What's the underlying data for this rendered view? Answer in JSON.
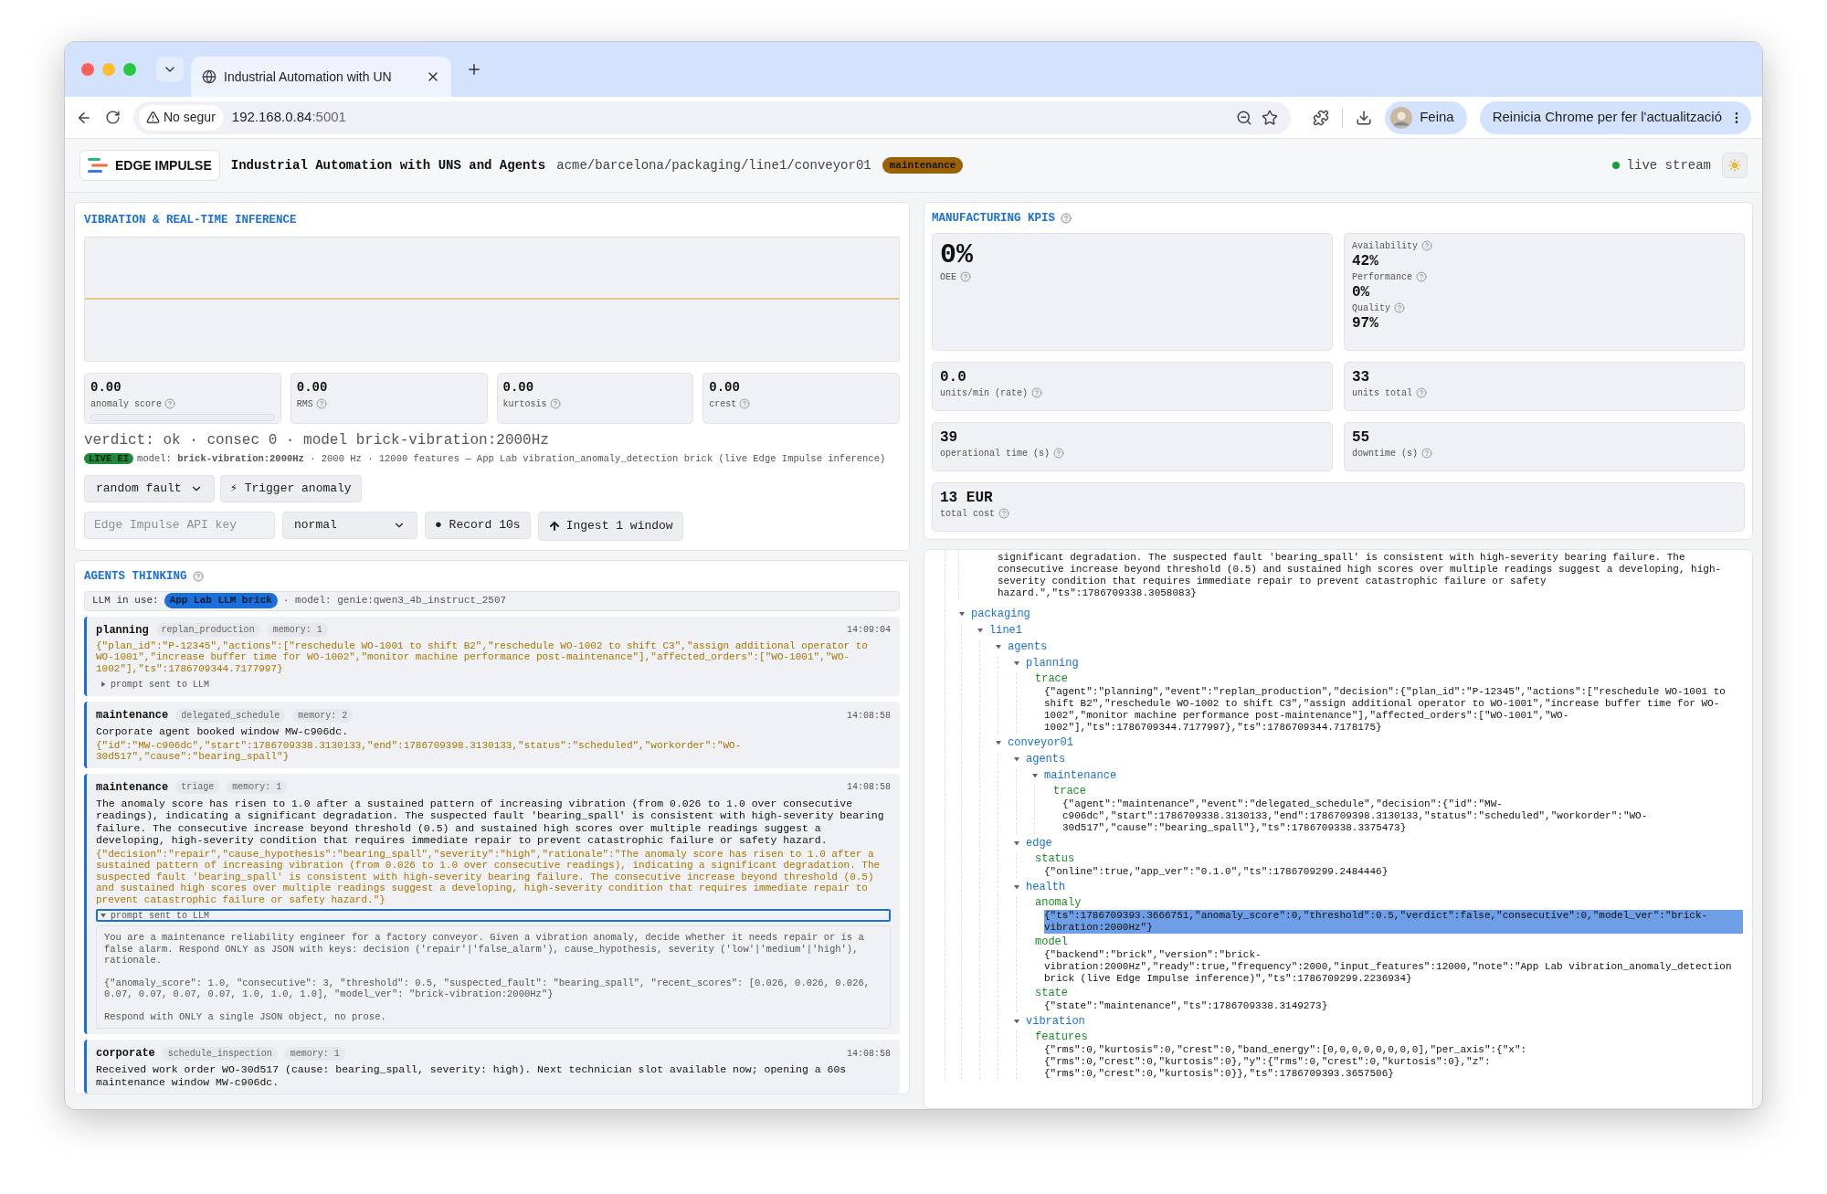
{
  "browser": {
    "tab": {
      "title": "Industrial Automation with UN"
    },
    "url": {
      "warning": "No segur",
      "host": "192.168.0.84",
      "port": ":5001"
    },
    "profile": {
      "name": "Feina"
    },
    "update_button": "Reinicia Chrome per fer l'actualització"
  },
  "header": {
    "brand": "EDGE IMPULSE",
    "title": "Industrial Automation with UNS and Agents",
    "path": "acme/barcelona/packaging/line1/conveyor01",
    "state_badge": "maintenance",
    "stream": {
      "label": "live stream",
      "live": true
    }
  },
  "vibration": {
    "title": "VIBRATION & REAL-TIME INFERENCE",
    "metrics": [
      {
        "value": "0.00",
        "label": "anomaly score",
        "help": true,
        "level": 0
      },
      {
        "value": "0.00",
        "label": "RMS",
        "help": true
      },
      {
        "value": "0.00",
        "label": "kurtosis",
        "help": true
      },
      {
        "value": "0.00",
        "label": "crest",
        "help": true
      }
    ],
    "verdict": "verdict: ok · consec 0 · model brick-vibration:2000Hz",
    "live_badge": "LIVE EI",
    "model_info": "model: **brick-vibration:2000Hz** · 2000 Hz · 12000 features — App Lab vibration_anomaly_detection brick (live Edge Impulse inference)",
    "fault_select": "random fault",
    "trigger_button": "⚡ Trigger anomaly",
    "api_key": {
      "placeholder": "Edge Impulse API key"
    },
    "mode_select": "normal",
    "record_button": "● Record 10s",
    "ingest_button": "Ingest 1 window"
  },
  "agents": {
    "title": "AGENTS THINKING",
    "help": true,
    "llm_label": "LLM in use:",
    "llm_badge": "App Lab LLM brick",
    "llm_model": "· model: genie:qwen3_4b_instruct_2507",
    "entries": [
      {
        "agent": "planning",
        "event": "replan_production",
        "memory": "memory: 1",
        "time": "14:09:04",
        "json": "{\"plan_id\":\"P-12345\",\"actions\":[\"reschedule WO-1001 to shift B2\",\"reschedule WO-1002 to shift C3\",\"assign additional operator to WO-1001\",\"increase buffer time for WO-1002\",\"monitor machine performance post-maintenance\"],\"affected_orders\":[\"WO-1001\",\"WO-1002\"],\"ts\":1786709344.7177997}",
        "prompt": {
          "label": "prompt sent to LLM",
          "expanded": false,
          "focused": false
        }
      },
      {
        "agent": "maintenance",
        "event": "delegated_schedule",
        "memory": "memory: 2",
        "time": "14:08:58",
        "summary": "Corporate agent booked window MW-c906dc.",
        "json": "{\"id\":\"MW-c906dc\",\"start\":1786709338.3130133,\"end\":1786709398.3130133,\"status\":\"scheduled\",\"workorder\":\"WO-30d517\",\"cause\":\"bearing_spall\"}"
      },
      {
        "agent": "maintenance",
        "event": "triage",
        "memory": "memory: 1",
        "time": "14:08:58",
        "summary": "The anomaly score has risen to 1.0 after a sustained pattern of increasing vibration (from 0.026 to 1.0 over consecutive readings), indicating a significant degradation. The suspected fault 'bearing_spall' is consistent with high-severity bearing failure. The consecutive increase beyond threshold (0.5) and sustained high scores over multiple readings suggest a developing, high-severity condition that requires immediate repair to prevent catastrophic failure or safety hazard.",
        "json": "{\"decision\":\"repair\",\"cause_hypothesis\":\"bearing_spall\",\"severity\":\"high\",\"rationale\":\"The anomaly score has risen to 1.0 after a sustained pattern of increasing vibration (from 0.026 to 1.0 over consecutive readings), indicating a significant degradation. The suspected fault 'bearing_spall' is consistent with high-severity bearing failure. The consecutive increase beyond threshold (0.5) and sustained high scores over multiple readings suggest a developing, high-severity condition that requires immediate repair to prevent catastrophic failure or safety hazard.\"}",
        "prompt": {
          "label": "prompt sent to LLM",
          "expanded": true,
          "focused": true,
          "paragraphs": [
            "You are a maintenance reliability engineer for a factory conveyor. Given a vibration anomaly, decide whether it needs repair or is a false alarm. Respond ONLY as JSON with keys: decision ('repair'|'false_alarm'), cause_hypothesis, severity ('low'|'medium'|'high'), rationale.",
            "{\"anomaly_score\": 1.0, \"consecutive\": 3, \"threshold\": 0.5, \"suspected_fault\": \"bearing_spall\", \"recent_scores\": [0.026, 0.026, 0.026, 0.07, 0.07, 0.07, 0.07, 1.0, 1.0, 1.0], \"model_ver\": \"brick-vibration:2000Hz\"}",
            "Respond with ONLY a single JSON object, no prose."
          ]
        }
      },
      {
        "agent": "corporate",
        "event": "schedule_inspection",
        "memory": "memory: 1",
        "time": "14:08:58",
        "summary": "Received work order WO-30d517 (cause: bearing_spall, severity: high). Next technician slot available now; opening a 60s maintenance window MW-c906dc."
      }
    ]
  },
  "kpis": {
    "title": "MANUFACTURING KPIS",
    "help": true,
    "oee": {
      "value": "0%",
      "label": "OEE",
      "help": true
    },
    "breakdown": [
      {
        "label": "Availability",
        "value": "42%",
        "help": true
      },
      {
        "label": "Performance",
        "value": "0%",
        "help": true
      },
      {
        "label": "Quality",
        "value": "97%",
        "help": true
      }
    ],
    "cards": [
      {
        "value": "0.0",
        "label": "units/min (rate)",
        "help": true
      },
      {
        "value": "33",
        "label": "units total",
        "help": true
      },
      {
        "value": "39",
        "label": "operational time (s)",
        "help": true
      },
      {
        "value": "55",
        "label": "downtime (s)",
        "help": true
      },
      {
        "value": "13 EUR",
        "label": "total cost",
        "help": true,
        "wide": true
      }
    ]
  },
  "tree": {
    "partial_value": "significant degradation. The suspected fault 'bearing_spall' is consistent with high-severity bearing failure. The consecutive increase beyond threshold (0.5) and sustained high scores over multiple readings suggest a developing, high-severity condition that requires immediate repair to prevent catastrophic failure or safety hazard.\",\"ts\":1786709338.3058083}",
    "nodes": [
      {
        "label": "packaging",
        "expanded": true,
        "children": [
          {
            "label": "line1",
            "expanded": true,
            "children": [
              {
                "label": "agents",
                "expanded": true,
                "children": [
                  {
                    "label": "planning",
                    "expanded": true,
                    "children": [
                      {
                        "kind": "leaf",
                        "key": "trace",
                        "selected": false,
                        "value": "{\"agent\":\"planning\",\"event\":\"replan_production\",\"decision\":{\"plan_id\":\"P-12345\",\"actions\":[\"reschedule WO-1001 to shift B2\",\"reschedule WO-1002 to shift C3\",\"assign additional operator to WO-1001\",\"increase buffer time for WO-1002\",\"monitor machine performance post-maintenance\"],\"affected_orders\":[\"WO-1001\",\"WO-1002\"],\"ts\":1786709344.7177997},\"ts\":1786709344.7178175}"
                      }
                    ]
                  }
                ]
              },
              {
                "label": "conveyor01",
                "expanded": true,
                "children": [
                  {
                    "label": "agents",
                    "expanded": true,
                    "children": [
                      {
                        "label": "maintenance",
                        "expanded": true,
                        "children": [
                          {
                            "kind": "leaf",
                            "key": "trace",
                            "selected": false,
                            "value": "{\"agent\":\"maintenance\",\"event\":\"delegated_schedule\",\"decision\":{\"id\":\"MW-c906dc\",\"start\":1786709338.3130133,\"end\":1786709398.3130133,\"status\":\"scheduled\",\"workorder\":\"WO-30d517\",\"cause\":\"bearing_spall\"},\"ts\":1786709338.3375473}"
                          }
                        ]
                      }
                    ]
                  },
                  {
                    "label": "edge",
                    "expanded": true,
                    "children": [
                      {
                        "kind": "leaf",
                        "key": "status",
                        "selected": false,
                        "value": "{\"online\":true,\"app_ver\":\"0.1.0\",\"ts\":1786709299.2484446}"
                      }
                    ]
                  },
                  {
                    "label": "health",
                    "expanded": true,
                    "children": [
                      {
                        "kind": "leaf",
                        "key": "anomaly",
                        "selected": true,
                        "value": "{\"ts\":1786709393.3666751,\"anomaly_score\":0,\"threshold\":0.5,\"verdict\":false,\"consecutive\":0,\"model_ver\":\"brick-vibration:2000Hz\"}"
                      },
                      {
                        "kind": "leaf",
                        "key": "model",
                        "selected": false,
                        "value": "{\"backend\":\"brick\",\"version\":\"brick-vibration:2000Hz\",\"ready\":true,\"frequency\":2000,\"input_features\":12000,\"note\":\"App Lab vibration_anomaly_detection brick (live Edge Impulse inference)\",\"ts\":1786709299.2236934}"
                      },
                      {
                        "kind": "leaf",
                        "key": "state",
                        "selected": false,
                        "value": "{\"state\":\"maintenance\",\"ts\":1786709338.3149273}"
                      }
                    ]
                  },
                  {
                    "label": "vibration",
                    "expanded": true,
                    "children": [
                      {
                        "kind": "leaf",
                        "key": "features",
                        "selected": false,
                        "value": "{\"rms\":0,\"kurtosis\":0,\"crest\":0,\"band_energy\":[0,0,0,0,0,0,0,0],\"per_axis\":{\"x\":{\"rms\":0,\"crest\":0,\"kurtosis\":0},\"y\":{\"rms\":0,\"crest\":0,\"kurtosis\":0},\"z\":{\"rms\":0,\"crest\":0,\"kurtosis\":0}},\"ts\":1786709393.3657506}"
                      }
                    ]
                  }
                ]
              }
            ]
          }
        ]
      }
    ]
  }
}
